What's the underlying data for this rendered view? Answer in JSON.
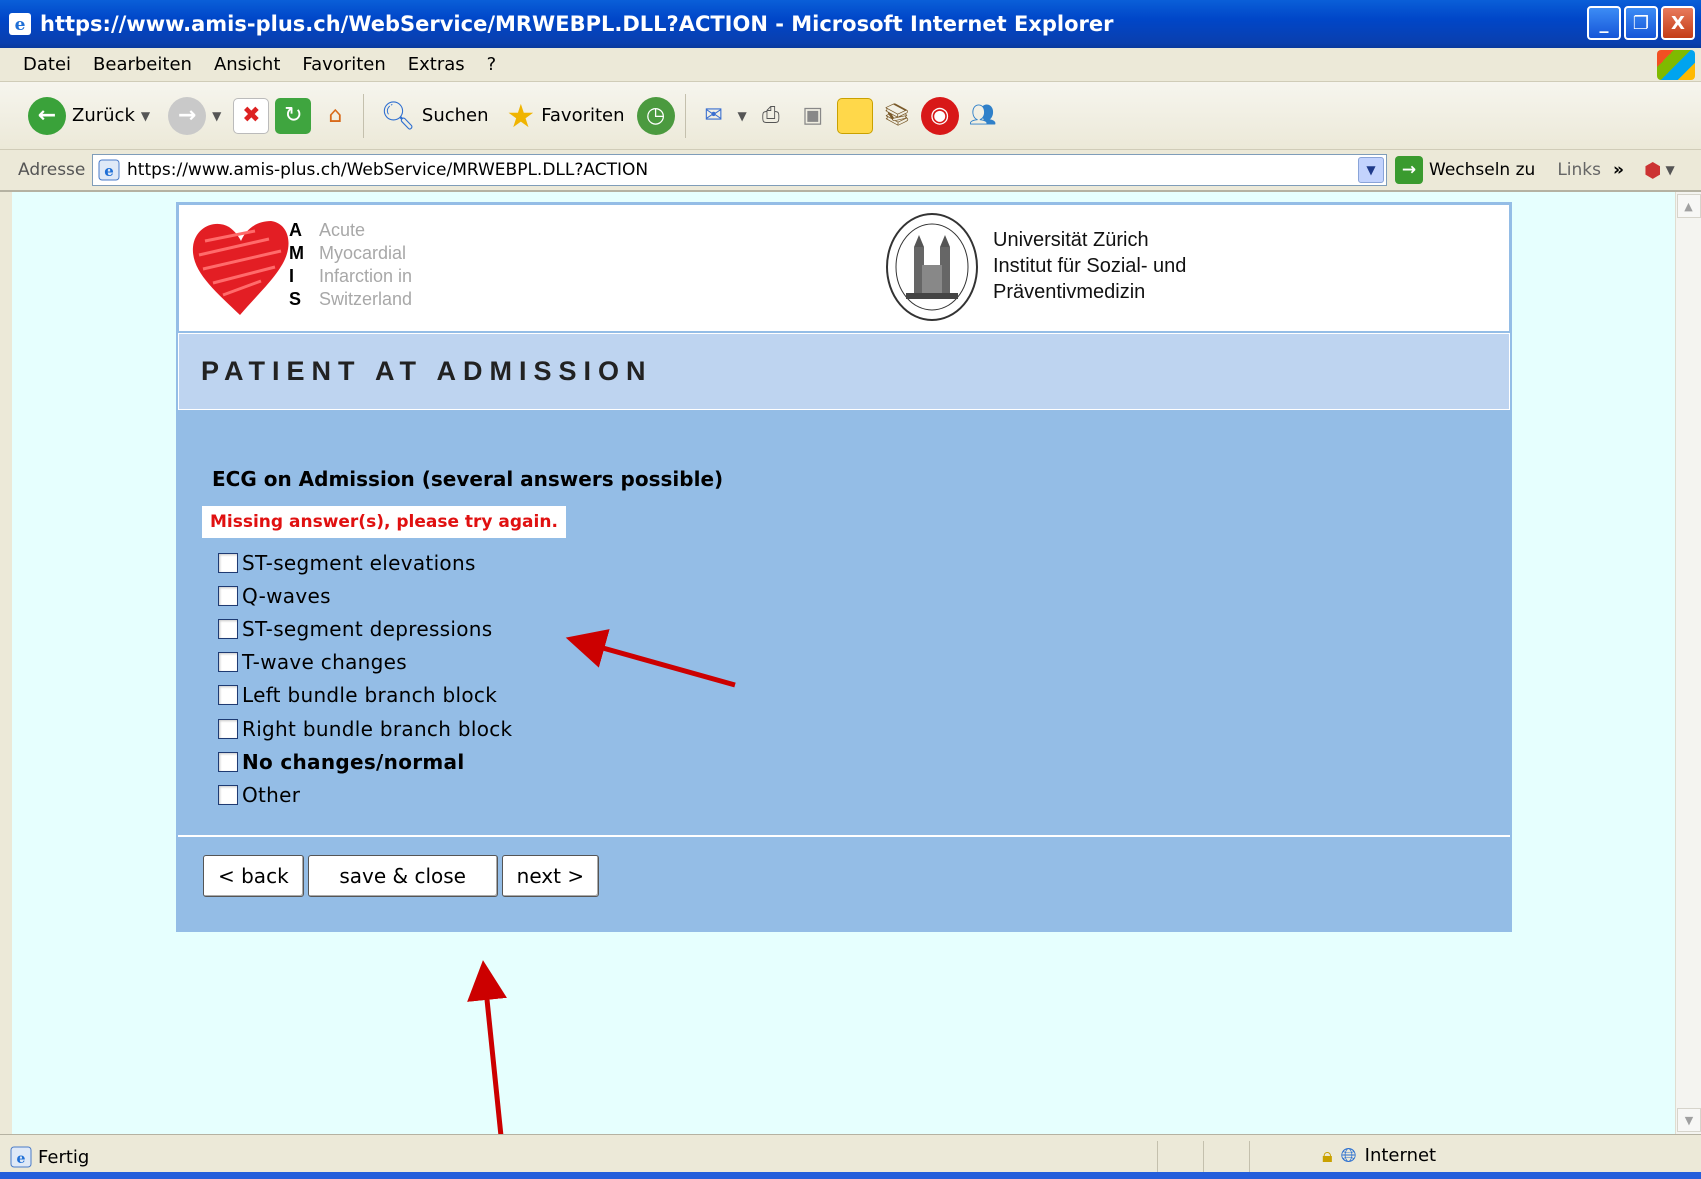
{
  "window": {
    "title": "https://www.amis-plus.ch/WebService/MRWEBPL.DLL?ACTION - Microsoft Internet Explorer",
    "minimize": "_",
    "restore": "❐",
    "close": "X"
  },
  "menu": {
    "items": [
      "Datei",
      "Bearbeiten",
      "Ansicht",
      "Favoriten",
      "Extras",
      "?"
    ]
  },
  "toolbar": {
    "back_label": "Zurück",
    "search_label": "Suchen",
    "favorites_label": "Favoriten"
  },
  "address": {
    "label": "Adresse",
    "url": "https://www.amis-plus.ch/WebService/MRWEBPL.DLL?ACTION",
    "go_label": "Wechseln zu",
    "links_label": "Links",
    "more": "»"
  },
  "header": {
    "amis_letters": [
      "A",
      "M",
      "I",
      "S"
    ],
    "amis_words": [
      "Acute",
      "Myocardial",
      "Infarction in",
      "Switzerland"
    ],
    "uzh_lines": [
      "Universität Zürich",
      "Institut für Sozial- und",
      "Präventivmedizin"
    ]
  },
  "section_title": "PATIENT AT ADMISSION",
  "question": "ECG on Admission (several answers possible)",
  "error_message": "Missing answer(s), please try again.",
  "options": [
    {
      "label": "ST-segment elevations",
      "checked": false
    },
    {
      "label": "Q-waves",
      "checked": false
    },
    {
      "label": "ST-segment depressions",
      "checked": false
    },
    {
      "label": "T-wave changes",
      "checked": false
    },
    {
      "label": "Left bundle branch block",
      "checked": false
    },
    {
      "label": "Right bundle branch block",
      "checked": false
    },
    {
      "label": "No changes/normal",
      "checked": false
    },
    {
      "label": "Other",
      "checked": false
    }
  ],
  "buttons": {
    "back": "< back",
    "save_close": "save & close",
    "next": "next >"
  },
  "status": {
    "text": "Fertig",
    "zone": "Internet"
  },
  "colors": {
    "panel_bg": "#94bde6",
    "section_bg": "#bed4f0",
    "page_bg": "#e6fffe",
    "error": "#e01010",
    "annotation_arrow": "#cc0000"
  }
}
